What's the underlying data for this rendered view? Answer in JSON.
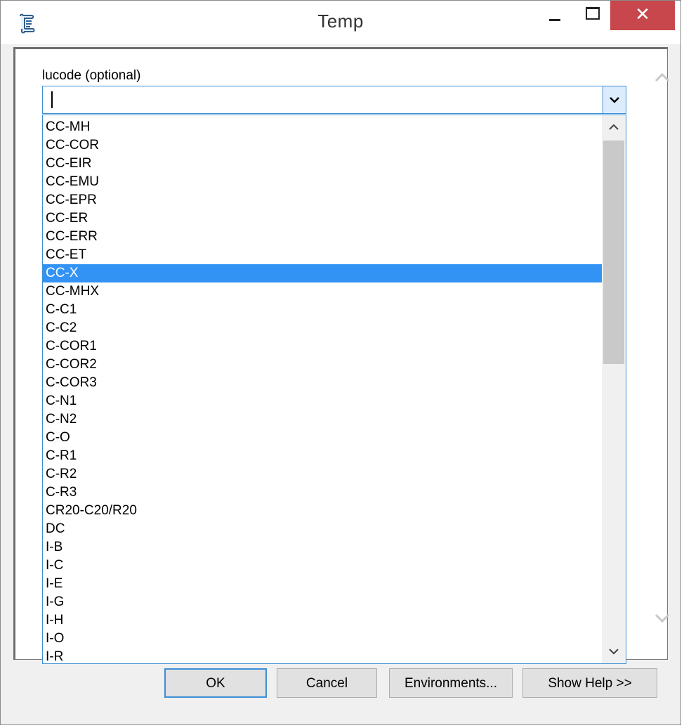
{
  "window": {
    "title": "Temp",
    "close_glyph": "✕"
  },
  "field": {
    "label": "lucode (optional)",
    "value": ""
  },
  "list": {
    "items": [
      "CC-MH",
      "CC-COR",
      "CC-EIR",
      "CC-EMU",
      "CC-EPR",
      "CC-ER",
      "CC-ERR",
      "CC-ET",
      "CC-X",
      "CC-MHX",
      "C-C1",
      "C-C2",
      "C-COR1",
      "C-COR2",
      "C-COR3",
      "C-N1",
      "C-N2",
      "C-O",
      "C-R1",
      "C-R2",
      "C-R3",
      "CR20-C20/R20",
      "DC",
      "I-B",
      "I-C",
      "I-E",
      "I-G",
      "I-H",
      "I-O",
      "I-R"
    ],
    "selected": "CC-X"
  },
  "buttons": {
    "ok": "OK",
    "cancel": "Cancel",
    "environments": "Environments...",
    "show_help": "Show Help >>"
  },
  "colors": {
    "selection": "#3393f5",
    "focus_border": "#3c8fd6",
    "close_button": "#c7474c"
  },
  "icons": {
    "app": "script-tool-icon",
    "minimize": "minimize-icon",
    "maximize": "maximize-icon",
    "close": "close-icon",
    "dropdown": "chevron-down-icon",
    "scroll_up": "chevron-up-icon",
    "scroll_down": "chevron-down-icon"
  }
}
